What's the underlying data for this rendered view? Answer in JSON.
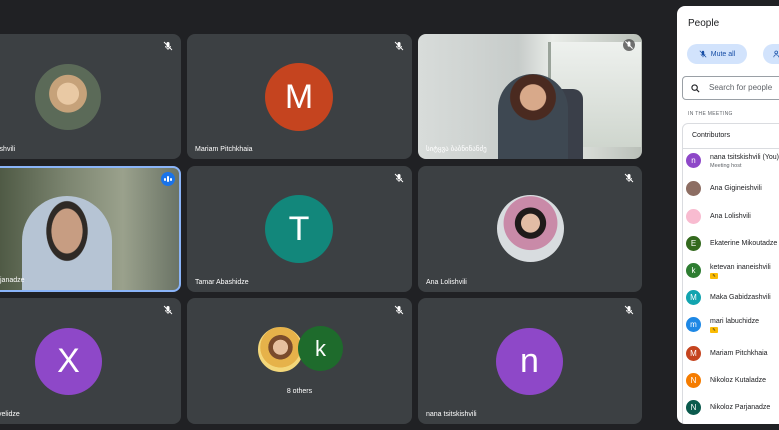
{
  "colors": {
    "tile_bg": "#3c4043",
    "page_bg": "#202124",
    "speaking_border": "#8ab4f8",
    "avatar_orange": "#c5441f",
    "avatar_teal": "#12877b",
    "avatar_purple": "#8e48c8"
  },
  "tiles": [
    {
      "name": "ishvili",
      "mic": "mic-off-icon"
    },
    {
      "name": "Mariam Pitchkhaia",
      "initial": "M",
      "mic": "mic-off-icon"
    },
    {
      "name": "სიტყვა ბაბნინანძე",
      "mic": "mic-off-icon"
    },
    {
      "name": "janadze",
      "mic": "speaking-indicator-icon"
    },
    {
      "name": "Tamar Abashidze",
      "initial": "T",
      "mic": "mic-off-icon"
    },
    {
      "name": "Ana Lolishvili",
      "mic": "mic-off-icon"
    },
    {
      "name": "velidze",
      "initial": "X",
      "mic": "mic-off-icon"
    },
    {
      "name": "8 others",
      "initial": "k",
      "mic": "mic-off-icon"
    },
    {
      "name": "nana tsitskishvili",
      "initial": "n",
      "mic": "mic-off-icon"
    }
  ],
  "panel": {
    "title": "People",
    "mute_all": "Mute all",
    "search_placeholder": "Search for people",
    "section_label": "IN THE MEETING",
    "contributors_label": "Contributors",
    "people": [
      {
        "name": "nana tsitskishvili (You)",
        "sub": "Meeting host",
        "initial": "n",
        "color": "#8e48c8"
      },
      {
        "name": "Ana Gigineishvili",
        "initial": "",
        "color": "#8d6e63"
      },
      {
        "name": "Ana Lolishvili",
        "initial": "",
        "color": "#f8bbd0"
      },
      {
        "name": "Ekaterine Mikoutadze",
        "initial": "E",
        "color": "#33691e"
      },
      {
        "name": "ketevan inaneishvili",
        "initial": "k",
        "color": "#2e7d32",
        "badge": true
      },
      {
        "name": "Maka Gabidzashvili",
        "initial": "M",
        "color": "#12a4af"
      },
      {
        "name": "mari labuchidze",
        "initial": "m",
        "color": "#1e88e5",
        "badge": true
      },
      {
        "name": "Mariam Pitchkhaia",
        "initial": "M",
        "color": "#c5441f"
      },
      {
        "name": "Nikoloz Kutaladze",
        "initial": "N",
        "color": "#f57c00"
      },
      {
        "name": "Nikoloz Parjanadze",
        "initial": "N",
        "color": "#0b5a4d"
      }
    ]
  }
}
